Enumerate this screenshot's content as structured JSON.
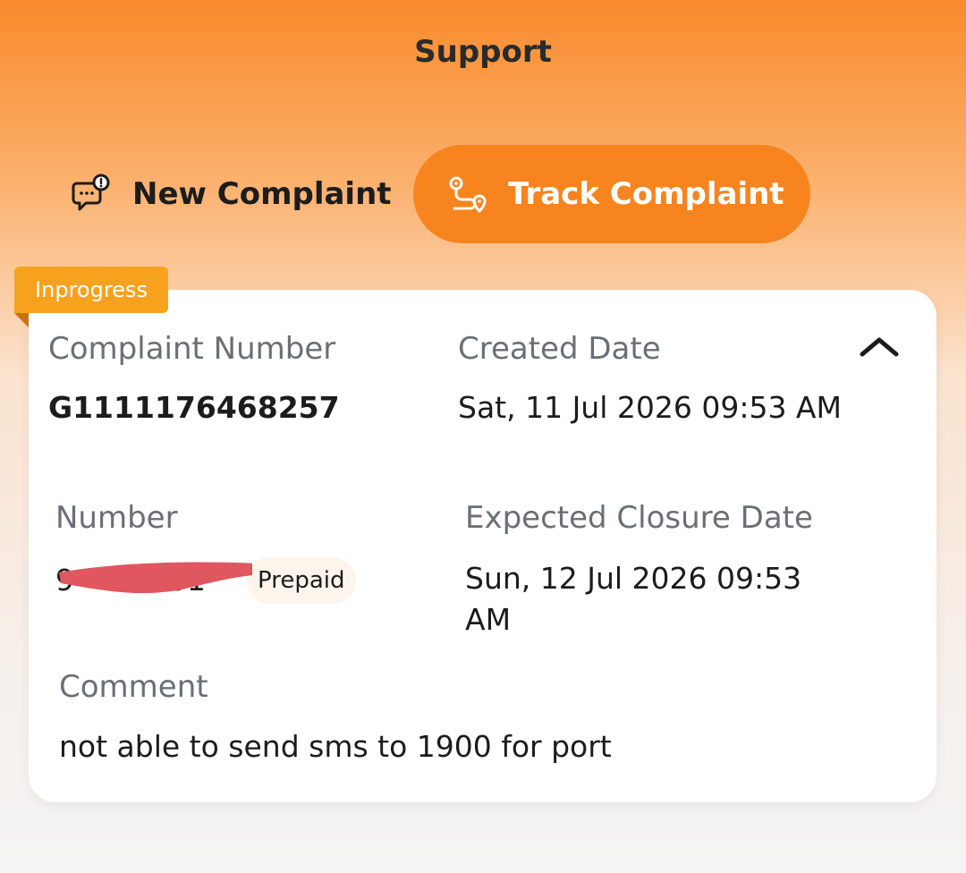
{
  "header": {
    "title": "Support"
  },
  "tabs": [
    {
      "label": "New Complaint",
      "icon": "chat-alert-icon",
      "active": false
    },
    {
      "label": "Track Complaint",
      "icon": "route-icon",
      "active": true
    }
  ],
  "colors": {
    "accent": "#f7841e",
    "badge": "#f7a21e",
    "header_gradient_top": "#f98a2c"
  },
  "complaint": {
    "status": "Inprogress",
    "complaint_number_label": "Complaint Number",
    "complaint_number": "G1111176468257",
    "created_date_label": "Created Date",
    "created_date": "Sat, 11 Jul 2026 09:53 AM",
    "number_label": "Number",
    "number_masked": "9··········01",
    "plan_type": "Prepaid",
    "expected_closure_label": "Expected Closure Date",
    "expected_closure": "Sun, 12 Jul 2026 09:53 AM",
    "comment_label": "Comment",
    "comment": "not able to send sms to 1900 for port",
    "collapse_icon": "chevron-up-icon"
  }
}
